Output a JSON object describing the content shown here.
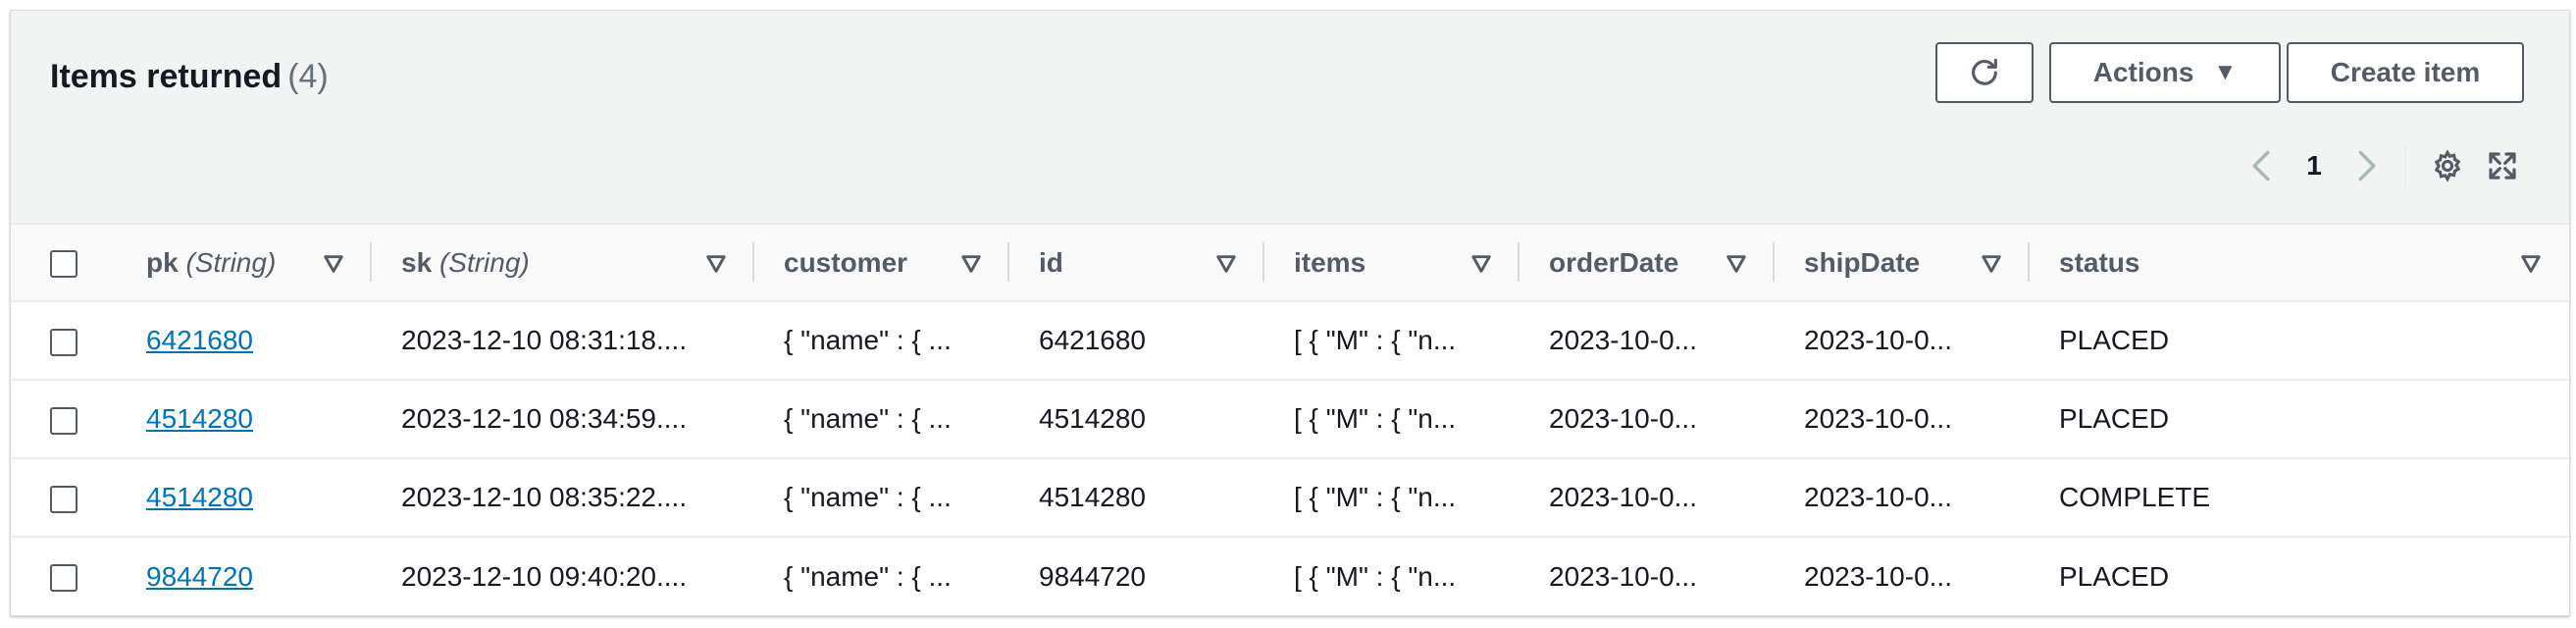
{
  "header": {
    "title": "Items returned",
    "count": "(4)",
    "actions_label": "Actions",
    "create_label": "Create item",
    "page_number": "1"
  },
  "columns": [
    {
      "name": "pk",
      "type": "(String)"
    },
    {
      "name": "sk",
      "type": "(String)"
    },
    {
      "name": "customer",
      "type": ""
    },
    {
      "name": "id",
      "type": ""
    },
    {
      "name": "items",
      "type": ""
    },
    {
      "name": "orderDate",
      "type": ""
    },
    {
      "name": "shipDate",
      "type": ""
    },
    {
      "name": "status",
      "type": ""
    }
  ],
  "rows": [
    {
      "pk": "6421680",
      "sk": "2023-12-10 08:31:18....",
      "customer": "{ \"name\" : { ...",
      "id": "6421680",
      "items": "[ { \"M\" : { \"n...",
      "orderDate": "2023-10-0...",
      "shipDate": "2023-10-0...",
      "status": "PLACED"
    },
    {
      "pk": "4514280",
      "sk": "2023-12-10 08:34:59....",
      "customer": "{ \"name\" : { ...",
      "id": "4514280",
      "items": "[ { \"M\" : { \"n...",
      "orderDate": "2023-10-0...",
      "shipDate": "2023-10-0...",
      "status": "PLACED"
    },
    {
      "pk": "4514280",
      "sk": "2023-12-10 08:35:22....",
      "customer": "{ \"name\" : { ...",
      "id": "4514280",
      "items": "[ { \"M\" : { \"n...",
      "orderDate": "2023-10-0...",
      "shipDate": "2023-10-0...",
      "status": "COMPLETE"
    },
    {
      "pk": "9844720",
      "sk": "2023-12-10 09:40:20....",
      "customer": "{ \"name\" : { ...",
      "id": "9844720",
      "items": "[ { \"M\" : { \"n...",
      "orderDate": "2023-10-0...",
      "shipDate": "2023-10-0...",
      "status": "PLACED"
    }
  ],
  "icons": {
    "refresh": "refresh-icon",
    "caret": "caret-down-icon",
    "prev": "chevron-left-icon",
    "next": "chevron-right-icon",
    "settings": "gear-icon",
    "fullscreen": "fullscreen-icon",
    "sort": "sort-caret-icon"
  },
  "colors": {
    "link": "#0073bb",
    "text": "#16191f",
    "muted": "#687078",
    "border": "#545b64"
  }
}
